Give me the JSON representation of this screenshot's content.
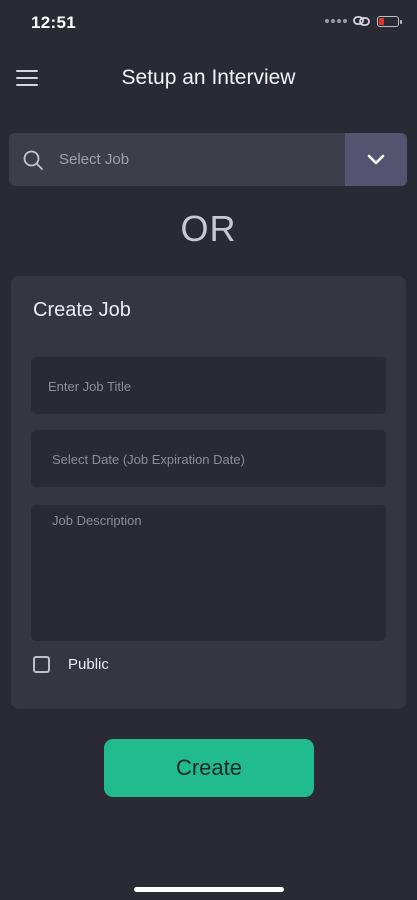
{
  "status_bar": {
    "time": "12:51",
    "icons": [
      "signal-dots-icon",
      "link-icon",
      "battery-icon"
    ],
    "battery_color": "#e0352b",
    "battery_level": 0.25
  },
  "header": {
    "title": "Setup an Interview",
    "menu_icon": "hamburger-menu-icon"
  },
  "select_job": {
    "placeholder": "Select Job",
    "search_icon": "search-icon",
    "dropdown_icon": "chevron-down-icon"
  },
  "divider_text": "OR",
  "create_job": {
    "title": "Create Job",
    "job_title_placeholder": "Enter Job Title",
    "date_placeholder": "Select Date (Job Expiration Date)",
    "description_placeholder": "Job Description",
    "public_label": "Public",
    "public_checked": false
  },
  "create_button": {
    "label": "Create",
    "color": "#22bb8e"
  }
}
